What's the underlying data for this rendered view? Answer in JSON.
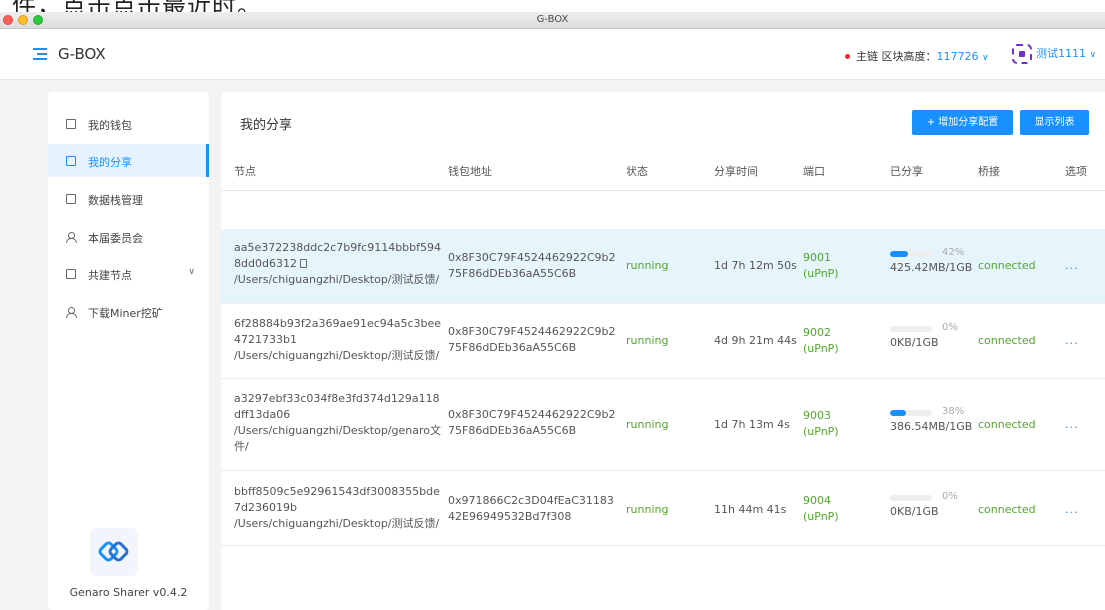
{
  "window": {
    "title": "G-BOX",
    "top_text": "件，点击点击最近时。"
  },
  "header": {
    "brand": "G-BOX",
    "chain_label": "主链 区块高度：",
    "block_height": "117726",
    "user_name": "测试1111"
  },
  "sidebar": {
    "items": [
      {
        "label": "我的钱包",
        "icon": "wallet-icon",
        "active": false
      },
      {
        "label": "我的分享",
        "icon": "share-list-icon",
        "active": true
      },
      {
        "label": "数据栈管理",
        "icon": "database-icon",
        "active": false
      },
      {
        "label": "本届委员会",
        "icon": "committee-icon",
        "active": false
      },
      {
        "label": "共建节点",
        "icon": "node-grid-icon",
        "active": false,
        "has_submenu": true
      },
      {
        "label": "下载Miner挖矿",
        "icon": "download-miner-icon",
        "active": false
      }
    ],
    "version": "Genaro Sharer v0.4.2"
  },
  "main": {
    "title": "我的分享",
    "add_button": "+ 增加分享配置",
    "list_button": "显示列表",
    "columns": [
      "节点",
      "钱包地址",
      "状态",
      "分享时间",
      "端口",
      "已分享",
      "桥接",
      "选项"
    ],
    "rows": [
      {
        "node_id": "aa5e372238ddc2c7b9fc9114bbbf5948dd0d6312",
        "path": "/Users/chiguangzhi/Desktop/测试反馈/",
        "wallet": "0x8F30C79F4524462922C9b275F86dDEb36aA55C6B",
        "status": "running",
        "share_time": "1d 7h 12m 50s",
        "port": "9001",
        "port_mode": "(uPnP)",
        "shared_percent": 42,
        "shared_percent_label": "42%",
        "shared_amount": "425.42MB/1GB",
        "bridge": "connected",
        "options": "...",
        "selected": true
      },
      {
        "node_id": "6f28884b93f2a369ae91ec94a5c3bee4721733b1",
        "path": "/Users/chiguangzhi/Desktop/测试反馈/",
        "wallet": "0x8F30C79F4524462922C9b275F86dDEb36aA55C6B",
        "status": "running",
        "share_time": "4d 9h 21m 44s",
        "port": "9002",
        "port_mode": "(uPnP)",
        "shared_percent": 0,
        "shared_percent_label": "0%",
        "shared_amount": "0KB/1GB",
        "bridge": "connected",
        "options": "..."
      },
      {
        "node_id": "a3297ebf33c034f8e3fd374d129a118dff13da06",
        "path": "/Users/chiguangzhi/Desktop/genaro文件/",
        "wallet": "0x8F30C79F4524462922C9b275F86dDEb36aA55C6B",
        "status": "running",
        "share_time": "1d 7h 13m 4s",
        "port": "9003",
        "port_mode": "(uPnP)",
        "shared_percent": 38,
        "shared_percent_label": "38%",
        "shared_amount": "386.54MB/1GB",
        "bridge": "connected",
        "options": "..."
      },
      {
        "node_id": "bbff8509c5e92961543df3008355bde7d236019b",
        "path": "/Users/chiguangzhi/Desktop/测试反馈/",
        "wallet": "0x971866C2c3D04fEaC3118342E96949532Bd7f308",
        "status": "running",
        "share_time": "11h 44m 41s",
        "port": "9004",
        "port_mode": "(uPnP)",
        "shared_percent": 0,
        "shared_percent_label": "0%",
        "shared_amount": "0KB/1GB",
        "bridge": "connected",
        "options": "..."
      }
    ]
  },
  "colors": {
    "accent": "#1890ff",
    "success": "#52a62c",
    "selected_row": "#e6f4fc"
  }
}
